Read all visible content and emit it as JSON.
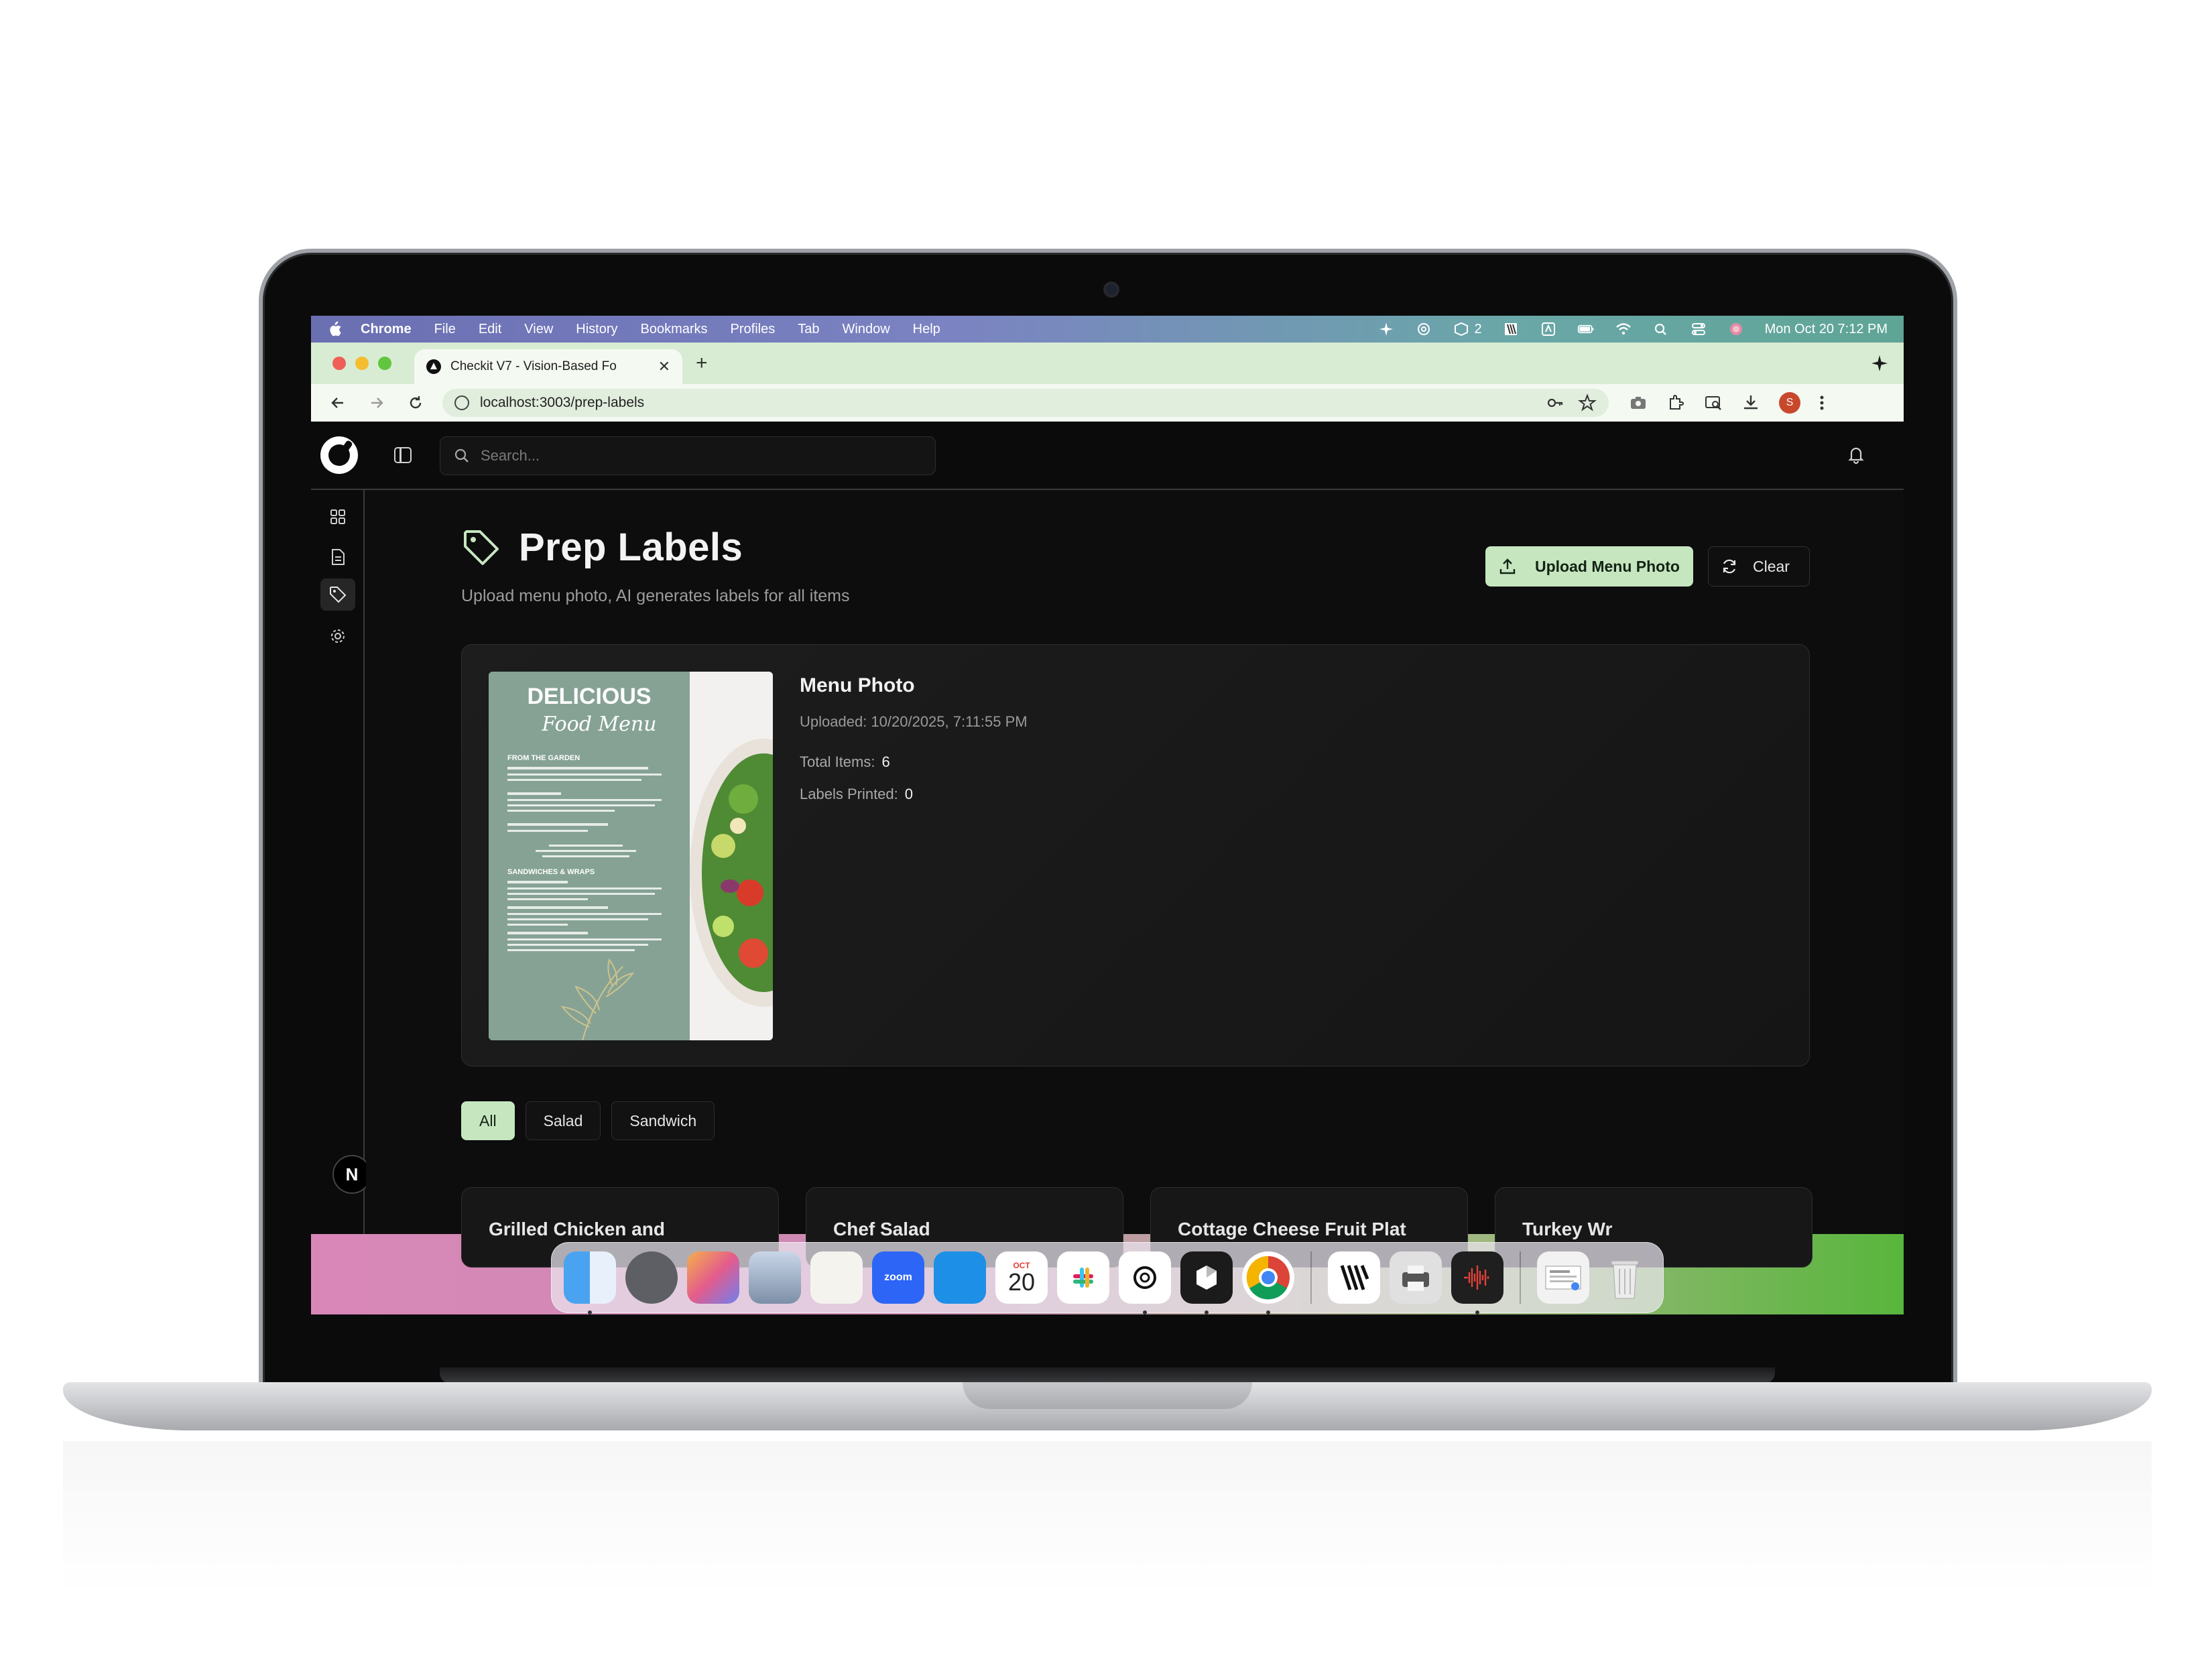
{
  "menubar": {
    "app_name": "Chrome",
    "items": [
      "File",
      "Edit",
      "View",
      "History",
      "Bookmarks",
      "Profiles",
      "Tab",
      "Window",
      "Help"
    ],
    "status_count": "2",
    "datetime": "Mon Oct 20  7:12 PM"
  },
  "browser": {
    "tab_title": "Checkit V7 - Vision-Based Fo",
    "url": "localhost:3003/prep-labels",
    "profile_initial": "S"
  },
  "app": {
    "search_placeholder": "Search...",
    "page_title": "Prep Labels",
    "page_subtitle": "Upload menu photo, AI generates labels for all items",
    "upload_button": "Upload Menu Photo",
    "clear_button": "Clear",
    "nav_badge": "N",
    "card": {
      "title": "Menu Photo",
      "uploaded": "Uploaded: 10/20/2025, 7:11:55 PM",
      "total_items_label": "Total Items:",
      "total_items_value": "6",
      "labels_printed_label": "Labels Printed:",
      "labels_printed_value": "0"
    },
    "menu_image": {
      "headline": "DELICIOUS",
      "script": "Food Menu",
      "section1": "FROM THE GARDEN",
      "section2": "SANDWICHES & WRAPS"
    },
    "filters": [
      "All",
      "Salad",
      "Sandwich"
    ],
    "item_cards": [
      "Grilled Chicken and",
      "Chef Salad",
      "Cottage Cheese Fruit Plat",
      "Turkey Wr"
    ]
  },
  "dock": {
    "calendar_month": "OCT",
    "calendar_day": "20",
    "zoom_label": "zoom"
  },
  "colors": {
    "accent": "#c6e6c0",
    "background": "#0d0d0d",
    "tabstrip": "#d8ecd3"
  }
}
